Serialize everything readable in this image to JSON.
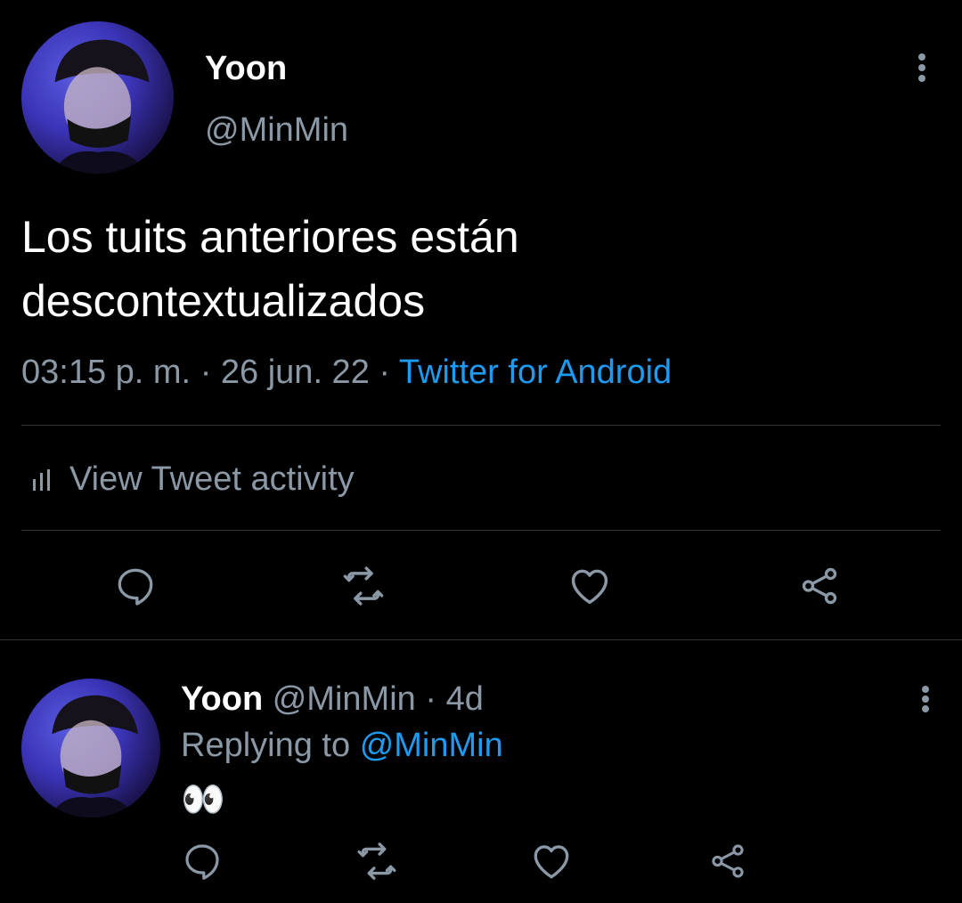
{
  "main_tweet": {
    "author_name": "Yoon",
    "handle": "@MinMin",
    "text_line1": "Los tuits anteriores están",
    "text_line2": "descontextualizados",
    "time": "03:15 p. m.",
    "sep1": "·",
    "date": "26 jun. 22",
    "sep2": "·",
    "source": "Twitter for Android",
    "activity_label": "View Tweet activity"
  },
  "reply": {
    "author_name": "Yoon",
    "handle": "@MinMin",
    "sep": "·",
    "age": "4d",
    "replying_prefix": "Replying to",
    "replying_handle": "@MinMin",
    "text": "👀"
  },
  "icons": {
    "reply": "reply-icon",
    "retweet": "retweet-icon",
    "like": "heart-icon",
    "share": "share-icon",
    "more": "more-vertical-icon",
    "activity": "bar-chart-icon"
  },
  "colors": {
    "background": "#000000",
    "text": "#ffffff",
    "muted": "#8b98a5",
    "link": "#1d9bf0",
    "divider": "#2f3336"
  }
}
